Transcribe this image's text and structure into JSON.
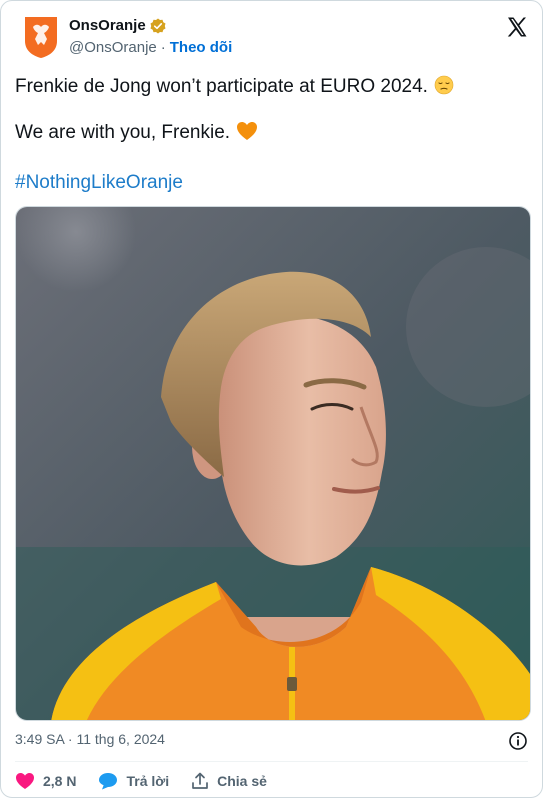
{
  "author": {
    "display_name": "OnsOranje",
    "handle": "@OnsOranje",
    "separator": "·",
    "follow_label": "Theo dõi",
    "brand_color": "#f36c21"
  },
  "tweet": {
    "line1": "Frenkie de Jong won’t participate at EURO 2024.",
    "line1_emoji": "pensive-face",
    "line2": "We are with you, Frenkie.",
    "line2_emoji": "orange-heart",
    "hashtag": "#NothingLikeOranje"
  },
  "meta": {
    "timestamp": "3:49 SA · 11 thg 6, 2024"
  },
  "actions": {
    "likes_count": "2,8 N",
    "reply_label": "Trả lời",
    "share_label": "Chia sẻ"
  },
  "colors": {
    "link": "#006fd6",
    "hashtag": "#1d7cc9",
    "like": "#f91880",
    "reply": "#1d9bf0"
  }
}
